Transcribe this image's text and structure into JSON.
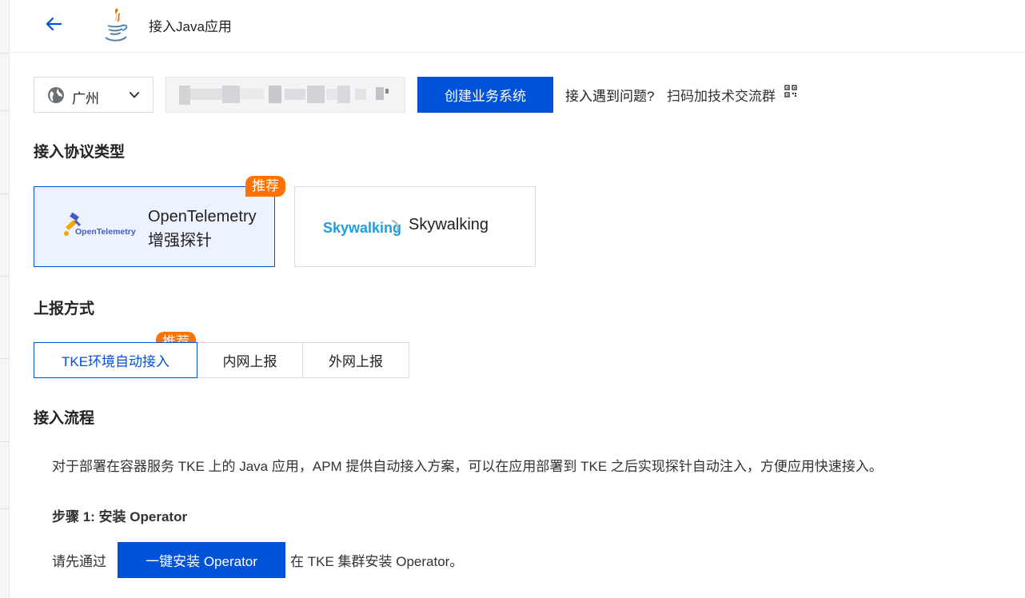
{
  "header": {
    "title": "接入Java应用",
    "back_icon": "arrow-left-icon",
    "app_icon": "java-icon"
  },
  "toolbar": {
    "region": "广州",
    "region_icon": "globe-icon",
    "business_system_value": "",
    "create_button": "创建业务系统",
    "help_prefix": "接入遇到问题?",
    "help_link": "扫码加技术交流群",
    "qr_icon": "qr-code-icon"
  },
  "protocol": {
    "title": "接入协议类型",
    "options": [
      {
        "label_line1": "OpenTelemetry",
        "label_line2": "增强探针",
        "logo": "opentelemetry-logo",
        "logo_text": "OpenTelemetry",
        "badge": "推荐",
        "selected": true
      },
      {
        "label": "Skywalking",
        "logo": "skywalking-logo",
        "logo_text": "Skywalking",
        "selected": false
      }
    ]
  },
  "report_method": {
    "title": "上报方式",
    "badge": "推荐",
    "tabs": [
      {
        "label": "TKE环境自动接入",
        "selected": true
      },
      {
        "label": "内网上报",
        "selected": false
      },
      {
        "label": "外网上报",
        "selected": false
      }
    ]
  },
  "flow": {
    "title": "接入流程",
    "description": "对于部署在容器服务 TKE 上的 Java 应用，APM 提供自动接入方案，可以在应用部署到 TKE 之后实现探针自动注入，方便应用快速接入。",
    "step1_title": "步骤 1:  安装 Operator",
    "step1_prefix": "请先通过",
    "step1_button": "一键安装 Operator",
    "step1_suffix": "在 TKE 集群安装 Operator。"
  },
  "colors": {
    "primary": "#0052d9",
    "badge": "#ff7200",
    "selected_bg": "#ecf2fe"
  }
}
